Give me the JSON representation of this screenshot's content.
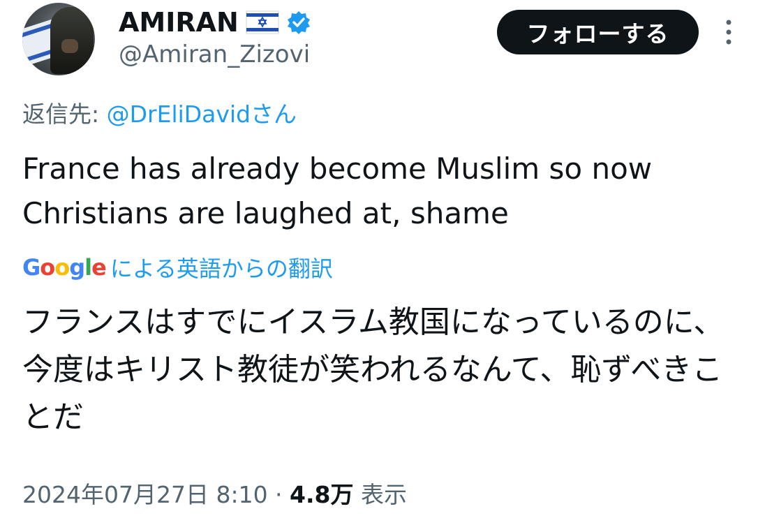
{
  "author": {
    "display_name": "AMIRAN",
    "handle": "@Amiran_Zizovi",
    "flag_icon": "israel-flag-icon",
    "verified_icon": "verified-badge-icon",
    "verified_color": "#1d9bf0"
  },
  "follow_button": {
    "label": "フォローする"
  },
  "reply": {
    "label": "返信先: ",
    "mention": "@DrEliDavidさん"
  },
  "tweet": {
    "text": "France has already become Muslim so now Christians are laughed at, shame"
  },
  "translation": {
    "provider": "Google",
    "label": "による英語からの翻訳",
    "text": "フランスはすでにイスラム教国になっているのに、今度はキリスト教徒が笑われるなんて、恥ずべきことだ"
  },
  "meta": {
    "timestamp": "2024年07月27日 8:10",
    "separator": " · ",
    "views_count": "4.8万",
    "views_label": " 表示"
  },
  "colors": {
    "text_primary": "#0f1419",
    "text_secondary": "#536471",
    "link": "#1d9bf0",
    "button_bg": "#0f1419"
  }
}
